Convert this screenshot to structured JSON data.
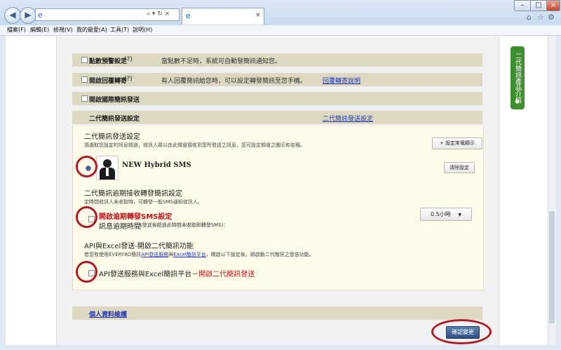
{
  "browser": {
    "address_icons": "⌕ ▾ ↻ ×",
    "tab_close": "×",
    "window_controls": [
      "–",
      "□",
      "×"
    ],
    "menu": [
      "檔案(F)",
      "編輯(E)",
      "檢視(V)",
      "我的最愛(A)",
      "工具(T)",
      "說明(H)"
    ]
  },
  "sections": {
    "alert_setting": {
      "label": "點數預警設定",
      "help": "(?)",
      "desc": "當點數不足時，系統可自動發簡訊通知您。"
    },
    "reply_forward": {
      "label": "開啟回覆轉寄",
      "help": "(?)",
      "desc": "有人回覆簡訊給您時，可以設定轉發簡訊至您手機。",
      "link": "回覆轉寄說明"
    },
    "intl_sms": {
      "label": "開啟國際簡訊發送"
    },
    "gen2": {
      "label": "二代簡訊發送設定",
      "link": "二代簡訊發送設定"
    }
  },
  "gen2_panel": {
    "title": "二代簡訊發送設定",
    "desc": "請選取您設定的訊息頻道，收訊人將以由此頻道接收到您所發送之訊息，您可設定頻道之圖示和名稱。",
    "set_icon_button": "+ 設定來電顯示",
    "channel_name": "NEW Hybrid SMS",
    "clear_button": "清除設定"
  },
  "expire_panel": {
    "title": "二代簡訊逾期接收轉發簡訊設定",
    "desc": "定時間收訊人未收取時，可轉發一般SMS通知收訊人。",
    "enable_label": "開啟逾期轉發SMS設定",
    "time_label": "訊息逾期時間",
    "time_note": "(發送後超過此時間未收取即轉發SMS)：",
    "time_value": "0.5小時"
  },
  "api_panel": {
    "title": "API與Excel發送-開啟二代簡訊功能",
    "desc_prefix": "若您有使用EVERY8D簡訊",
    "desc_link1": "API發送服務",
    "desc_mid": "與",
    "desc_link2": "Excel簡訊平台",
    "desc_suffix": "，開啟以下設定後，將啟動二代簡訊之發送功能。",
    "enable_label_black": "API發送服務與Excel簡訊平台－",
    "enable_label_red": "開啟二代簡訊發送"
  },
  "profile_link": "個人資料維護",
  "confirm_button": "確認變更",
  "side_tab": "二代簡訊產品介紹",
  "colors": {
    "accent_red": "#c0141d",
    "link_blue": "#2439b0",
    "bar_tan": "#ddd8c2",
    "panel_cream": "#fefce9",
    "side_green": "#3e8f2d"
  }
}
